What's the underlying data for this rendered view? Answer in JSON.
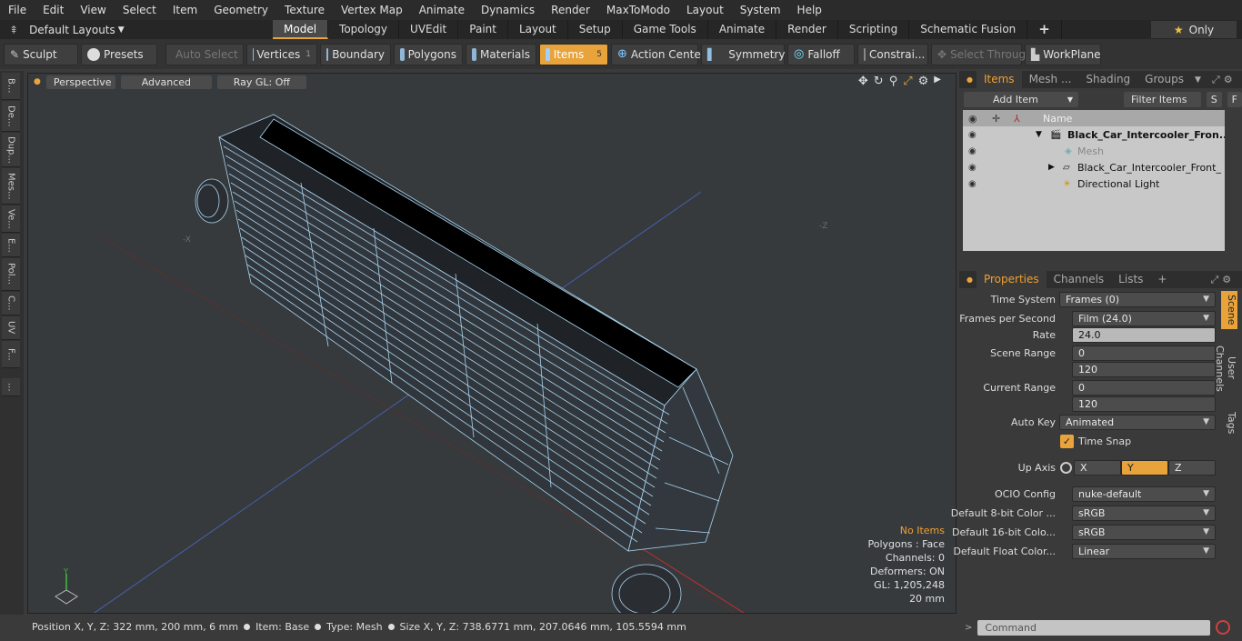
{
  "menu": [
    "File",
    "Edit",
    "View",
    "Select",
    "Item",
    "Geometry",
    "Texture",
    "Vertex Map",
    "Animate",
    "Dynamics",
    "Render",
    "MaxToModo",
    "Layout",
    "System",
    "Help"
  ],
  "layouts": {
    "label": "Default Layouts"
  },
  "tabs": [
    {
      "label": "Model",
      "active": true
    },
    {
      "label": "Topology"
    },
    {
      "label": "UVEdit"
    },
    {
      "label": "Paint"
    },
    {
      "label": "Layout"
    },
    {
      "label": "Setup"
    },
    {
      "label": "Game Tools"
    },
    {
      "label": "Animate"
    },
    {
      "label": "Render"
    },
    {
      "label": "Scripting"
    },
    {
      "label": "Schematic Fusion"
    },
    {
      "label": "+"
    }
  ],
  "only_label": "Only",
  "toolbar": {
    "sculpt": "Sculpt",
    "presets": "Presets",
    "auto_select": "Auto Select",
    "vertices": "Vertices",
    "vertices_count": "1",
    "boundary": "Boundary",
    "polygons": "Polygons",
    "materials": "Materials",
    "items": "Items",
    "items_count": "5",
    "action_center": "Action Center",
    "symmetry": "Symmetry",
    "falloff": "Falloff",
    "constraints": "Constrai...",
    "select_through": "Select Through",
    "workplane": "WorkPlane"
  },
  "left_tabs": [
    "B...",
    "De...",
    "Dup...",
    "Mes...",
    "Ve...",
    "E...",
    "Pol...",
    "C...",
    "UV",
    "F...",
    "..."
  ],
  "viewport": {
    "perspective": "Perspective",
    "advanced": "Advanced",
    "raygl": "Ray GL: Off",
    "stats": {
      "no_items": "No Items",
      "polygons": "Polygons : Face",
      "channels": "Channels: 0",
      "deformers": "Deformers: ON",
      "gl": "GL: 1,205,248",
      "scale": "20 mm"
    }
  },
  "status": {
    "position": "Position X, Y, Z:  322 mm, 200 mm, 6 mm",
    "item": "Item:  Base",
    "type": "Type:  Mesh",
    "size": "Size X, Y, Z:   738.6771 mm, 207.0646 mm, 105.5594 mm"
  },
  "items_panel": {
    "tabs": [
      "Items",
      "Mesh ...",
      "Shading",
      "Groups"
    ],
    "add_item": "Add Item",
    "filter_items": "Filter Items",
    "s": "S",
    "f": "F",
    "name_header": "Name",
    "rows": [
      {
        "label": "Black_Car_Intercooler_Fron...",
        "bold": true
      },
      {
        "label": "Mesh",
        "muted": true
      },
      {
        "label": "Black_Car_Intercooler_Front_ ..."
      },
      {
        "label": "Directional Light"
      }
    ]
  },
  "properties": {
    "tabs": [
      "Properties",
      "Channels",
      "Lists",
      "+"
    ],
    "time_system": {
      "label": "Time System",
      "value": "Frames (0)"
    },
    "fps": {
      "label": "Frames per Second",
      "value": "Film (24.0)"
    },
    "rate": {
      "label": "Rate",
      "value": "24.0"
    },
    "scene_range": {
      "label": "Scene Range",
      "start": "0",
      "end": "120"
    },
    "current_range": {
      "label": "Current Range",
      "start": "0",
      "end": "120"
    },
    "auto_key": {
      "label": "Auto Key",
      "value": "Animated"
    },
    "time_snap": "Time Snap",
    "up_axis": {
      "label": "Up Axis",
      "x": "X",
      "y": "Y",
      "z": "Z",
      "selected": "Y"
    },
    "ocio": {
      "label": "OCIO Config",
      "value": "nuke-default"
    },
    "c8": {
      "label": "Default 8-bit Color ...",
      "value": "sRGB"
    },
    "c16": {
      "label": "Default 16-bit Colo...",
      "value": "sRGB"
    },
    "cf": {
      "label": "Default Float Color...",
      "value": "Linear"
    },
    "side_tabs": [
      "Scene",
      "User Channels",
      "Tags"
    ]
  },
  "command": {
    "placeholder": "Command"
  },
  "colors": {
    "accent": "#e8a33a",
    "wire": "#a9d4f0",
    "viewport_bg": "#363a3c"
  }
}
